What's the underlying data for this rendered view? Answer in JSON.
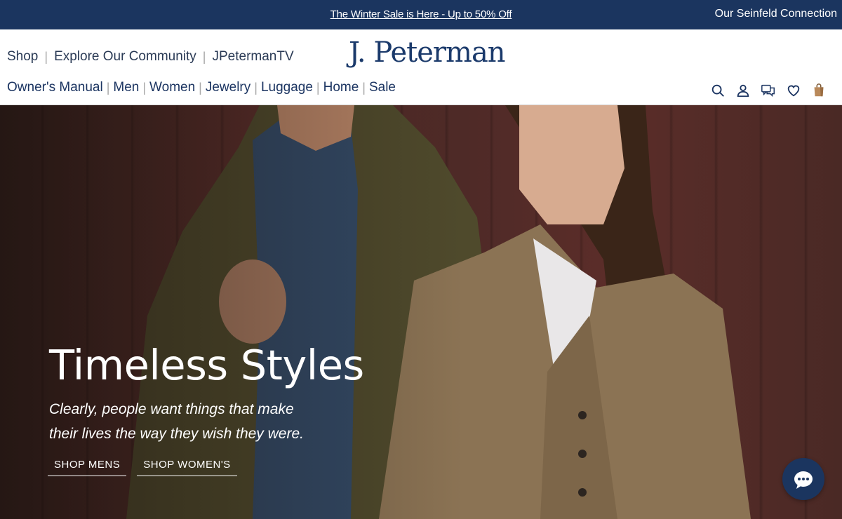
{
  "announcement": {
    "sale_text": "The Winter Sale is Here - Up to 50% Off",
    "seinfeld_link": "Our Seinfeld Connection"
  },
  "header": {
    "logo": "J. Peterman",
    "top_nav": [
      "Shop",
      "Explore Our Community",
      "JPetermanTV"
    ],
    "category_nav": [
      "Owner's Manual",
      "Men",
      "Women",
      "Jewelry",
      "Luggage",
      "Home",
      "Sale"
    ],
    "icons": [
      "search-icon",
      "account-icon",
      "chat-bubbles-icon",
      "wishlist-heart-icon",
      "shopping-bag-icon"
    ]
  },
  "hero": {
    "title": "Timeless Styles",
    "subtitle": "Clearly, people want things that make their lives the way they wish they were.",
    "cta_mens": "SHOP MENS",
    "cta_womens": "SHOP WOMEN'S"
  },
  "colors": {
    "brand_navy": "#1b355f",
    "text_navy": "#1b3461",
    "hero_wall": "#5a2e2a"
  }
}
